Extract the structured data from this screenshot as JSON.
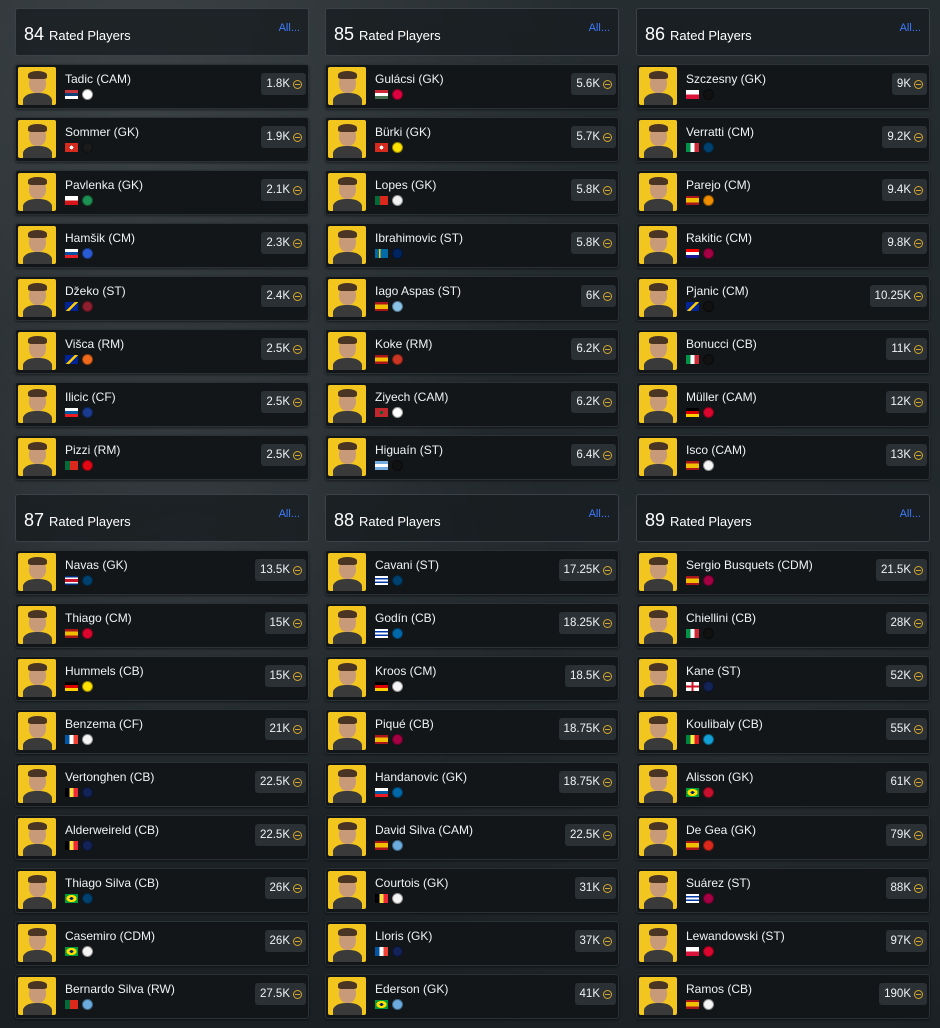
{
  "panels": [
    {
      "rating": "84",
      "label": "Rated Players",
      "all": "All...",
      "players": [
        {
          "name": "Tadic (CAM)",
          "price": "1.8K",
          "flag": "serbia",
          "club": "ajax"
        },
        {
          "name": "Sommer (GK)",
          "price": "1.9K",
          "flag": "switzerland",
          "club": "gladbach"
        },
        {
          "name": "Pavlenka (GK)",
          "price": "2.1K",
          "flag": "czechia",
          "club": "werder"
        },
        {
          "name": "Hamšik (CM)",
          "price": "2.3K",
          "flag": "slovakia",
          "club": "dalian"
        },
        {
          "name": "Džeko (ST)",
          "price": "2.4K",
          "flag": "bosnia",
          "club": "roma"
        },
        {
          "name": "Višca (RM)",
          "price": "2.5K",
          "flag": "bosnia",
          "club": "basaksehir"
        },
        {
          "name": "Ilicic (CF)",
          "price": "2.5K",
          "flag": "slovenia",
          "club": "atalanta"
        },
        {
          "name": "Pizzi (RM)",
          "price": "2.5K",
          "flag": "portugal",
          "club": "benfica"
        }
      ]
    },
    {
      "rating": "85",
      "label": "Rated Players",
      "all": "All...",
      "players": [
        {
          "name": "Gulácsi (GK)",
          "price": "5.6K",
          "flag": "hungary",
          "club": "leipzig"
        },
        {
          "name": "Bürki (GK)",
          "price": "5.7K",
          "flag": "switzerland",
          "club": "dortmund"
        },
        {
          "name": "Lopes (GK)",
          "price": "5.8K",
          "flag": "portugal",
          "club": "lyon"
        },
        {
          "name": "Ibrahimovic (ST)",
          "price": "5.8K",
          "flag": "sweden",
          "club": "galaxy"
        },
        {
          "name": "Iago Aspas (ST)",
          "price": "6K",
          "flag": "spain",
          "club": "celta"
        },
        {
          "name": "Koke (RM)",
          "price": "6.2K",
          "flag": "spain",
          "club": "atletico"
        },
        {
          "name": "Ziyech (CAM)",
          "price": "6.2K",
          "flag": "morocco",
          "club": "ajax"
        },
        {
          "name": "Higuaín (ST)",
          "price": "6.4K",
          "flag": "argentina",
          "club": "juventus"
        }
      ]
    },
    {
      "rating": "86",
      "label": "Rated Players",
      "all": "All...",
      "players": [
        {
          "name": "Szczesny (GK)",
          "price": "9K",
          "flag": "poland",
          "club": "juventus"
        },
        {
          "name": "Verratti (CM)",
          "price": "9.2K",
          "flag": "italy",
          "club": "psg"
        },
        {
          "name": "Parejo (CM)",
          "price": "9.4K",
          "flag": "spain",
          "club": "valencia"
        },
        {
          "name": "Rakitic (CM)",
          "price": "9.8K",
          "flag": "croatia",
          "club": "barcelona"
        },
        {
          "name": "Pjanic (CM)",
          "price": "10.25K",
          "flag": "bosnia",
          "club": "juventus"
        },
        {
          "name": "Bonucci (CB)",
          "price": "11K",
          "flag": "italy",
          "club": "juventus"
        },
        {
          "name": "Müller (CAM)",
          "price": "12K",
          "flag": "germany",
          "club": "bayern"
        },
        {
          "name": "Isco (CAM)",
          "price": "13K",
          "flag": "spain",
          "club": "realmadrid"
        }
      ]
    },
    {
      "rating": "87",
      "label": "Rated Players",
      "all": "All...",
      "players": [
        {
          "name": "Navas (GK)",
          "price": "13.5K",
          "flag": "costarica",
          "club": "psg"
        },
        {
          "name": "Thiago (CM)",
          "price": "15K",
          "flag": "spain",
          "club": "bayern"
        },
        {
          "name": "Hummels (CB)",
          "price": "15K",
          "flag": "germany",
          "club": "dortmund"
        },
        {
          "name": "Benzema (CF)",
          "price": "21K",
          "flag": "france",
          "club": "realmadrid"
        },
        {
          "name": "Vertonghen (CB)",
          "price": "22.5K",
          "flag": "belgium",
          "club": "spurs"
        },
        {
          "name": "Alderweireld (CB)",
          "price": "22.5K",
          "flag": "belgium",
          "club": "spurs"
        },
        {
          "name": "Thiago Silva (CB)",
          "price": "26K",
          "flag": "brazil",
          "club": "psg"
        },
        {
          "name": "Casemiro (CDM)",
          "price": "26K",
          "flag": "brazil",
          "club": "realmadrid"
        },
        {
          "name": "Bernardo Silva (RW)",
          "price": "27.5K",
          "flag": "portugal",
          "club": "mancity"
        }
      ]
    },
    {
      "rating": "88",
      "label": "Rated Players",
      "all": "All...",
      "players": [
        {
          "name": "Cavani (ST)",
          "price": "17.25K",
          "flag": "uruguay",
          "club": "psg"
        },
        {
          "name": "Godín (CB)",
          "price": "18.25K",
          "flag": "uruguay",
          "club": "inter"
        },
        {
          "name": "Kroos (CM)",
          "price": "18.5K",
          "flag": "germany",
          "club": "realmadrid"
        },
        {
          "name": "Piqué (CB)",
          "price": "18.75K",
          "flag": "spain",
          "club": "barcelona"
        },
        {
          "name": "Handanovic (GK)",
          "price": "18.75K",
          "flag": "slovenia",
          "club": "inter"
        },
        {
          "name": "David Silva (CAM)",
          "price": "22.5K",
          "flag": "spain",
          "club": "mancity"
        },
        {
          "name": "Courtois (GK)",
          "price": "31K",
          "flag": "belgium",
          "club": "realmadrid"
        },
        {
          "name": "Lloris (GK)",
          "price": "37K",
          "flag": "france",
          "club": "spurs"
        },
        {
          "name": "Ederson (GK)",
          "price": "41K",
          "flag": "brazil",
          "club": "mancity"
        }
      ]
    },
    {
      "rating": "89",
      "label": "Rated Players",
      "all": "All...",
      "players": [
        {
          "name": "Sergio Busquets (CDM)",
          "price": "21.5K",
          "flag": "spain",
          "club": "barcelona"
        },
        {
          "name": "Chiellini (CB)",
          "price": "28K",
          "flag": "italy",
          "club": "juventus"
        },
        {
          "name": "Kane (ST)",
          "price": "52K",
          "flag": "england",
          "club": "spurs"
        },
        {
          "name": "Koulibaly (CB)",
          "price": "55K",
          "flag": "senegal",
          "club": "napoli"
        },
        {
          "name": "Alisson (GK)",
          "price": "61K",
          "flag": "brazil",
          "club": "liverpool"
        },
        {
          "name": "De Gea (GK)",
          "price": "79K",
          "flag": "spain",
          "club": "manutd"
        },
        {
          "name": "Suárez (ST)",
          "price": "88K",
          "flag": "uruguay",
          "club": "barcelona"
        },
        {
          "name": "Lewandowski (ST)",
          "price": "97K",
          "flag": "poland",
          "club": "bayern"
        },
        {
          "name": "Ramos (CB)",
          "price": "190K",
          "flag": "spain",
          "club": "realmadrid"
        }
      ]
    }
  ],
  "colors": {
    "accent_link": "#3d7bff",
    "card_yellow": "#f2c51f",
    "coin_gold": "#d5a82b"
  }
}
